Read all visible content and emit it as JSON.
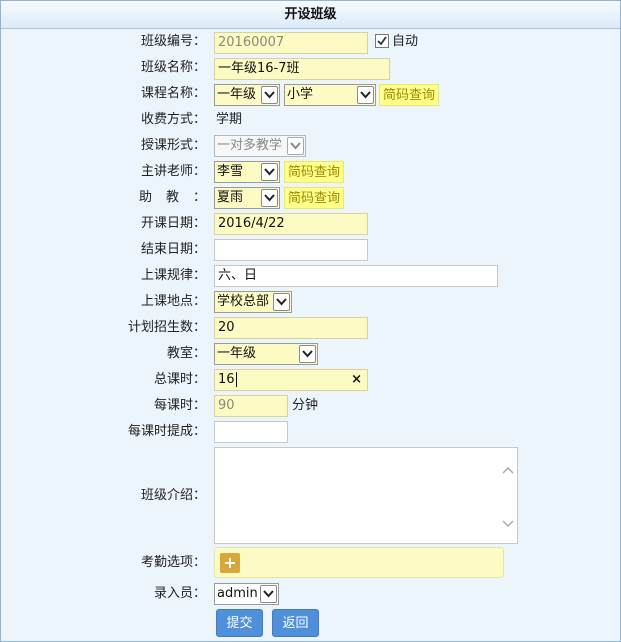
{
  "title": "开设班级",
  "fields": {
    "class_no": {
      "label": "班级编号：",
      "value": "20160007",
      "auto_label": "自动",
      "auto_checked": true
    },
    "class_name": {
      "label": "班级名称：",
      "value": "一年级16-7班"
    },
    "course": {
      "label": "课程名称：",
      "grade": "一年级",
      "subject": "小学",
      "lookup": "简码查询"
    },
    "fee_mode": {
      "label": "收费方式：",
      "value": "学期"
    },
    "teach_form": {
      "label": "授课形式：",
      "value": "一对多教学"
    },
    "teacher": {
      "label": "主讲老师：",
      "value": "李雪",
      "lookup": "简码查询"
    },
    "assistant": {
      "label": "助教",
      "colon": "：",
      "value": "夏雨",
      "lookup": "简码查询"
    },
    "start_date": {
      "label": "开课日期：",
      "value": "2016/4/22"
    },
    "end_date": {
      "label": "结束日期：",
      "value": ""
    },
    "schedule": {
      "label": "上课规律：",
      "value": "六、日"
    },
    "location": {
      "label": "上课地点：",
      "value": "学校总部"
    },
    "enroll": {
      "label": "计划招生数：",
      "value": "20"
    },
    "classroom": {
      "label": "教室：",
      "value": "一年级"
    },
    "total_hours": {
      "label": "总课时：",
      "value": "16",
      "clear": "×"
    },
    "per_hour": {
      "label": "每课时：",
      "value": "90",
      "unit": "分钟"
    },
    "commission": {
      "label": "每课时提成：",
      "value": ""
    },
    "intro": {
      "label": "班级介绍：",
      "value": ""
    },
    "attendance": {
      "label": "考勤选项：",
      "add": "+"
    },
    "entered_by": {
      "label": "录入员：",
      "value": "admin"
    }
  },
  "buttons": {
    "submit": "提交",
    "back": "返回"
  },
  "colors": {
    "field_bg": "#fdfbc4",
    "lookup_bg": "#ffff8c",
    "button": "#4f90d8",
    "frame_bg": "#ecf4fc"
  }
}
